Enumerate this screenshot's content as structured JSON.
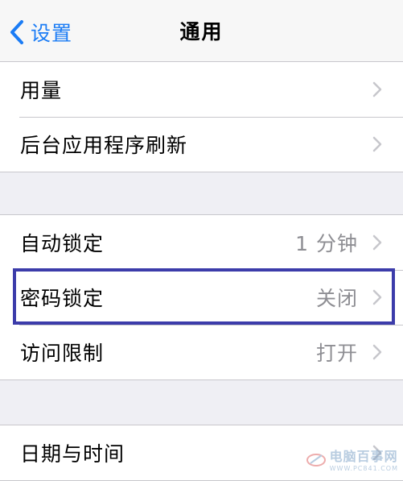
{
  "navbar": {
    "back_label": "设置",
    "title": "通用"
  },
  "group1": {
    "items": [
      {
        "label": "用量",
        "value": ""
      },
      {
        "label": "后台应用程序刷新",
        "value": ""
      }
    ]
  },
  "group2": {
    "items": [
      {
        "label": "自动锁定",
        "value": "1 分钟"
      },
      {
        "label": "密码锁定",
        "value": "关闭"
      },
      {
        "label": "访问限制",
        "value": "打开"
      }
    ]
  },
  "group3": {
    "items": [
      {
        "label": "日期与时间",
        "value": ""
      }
    ]
  },
  "watermark": {
    "main": "电脑百事网",
    "sub": "WWW.PC841.COM"
  },
  "colors": {
    "accent": "#1b7cf5",
    "highlight_border": "#3c3caa",
    "secondary_text": "#8e8e93",
    "background": "#efeff4"
  }
}
